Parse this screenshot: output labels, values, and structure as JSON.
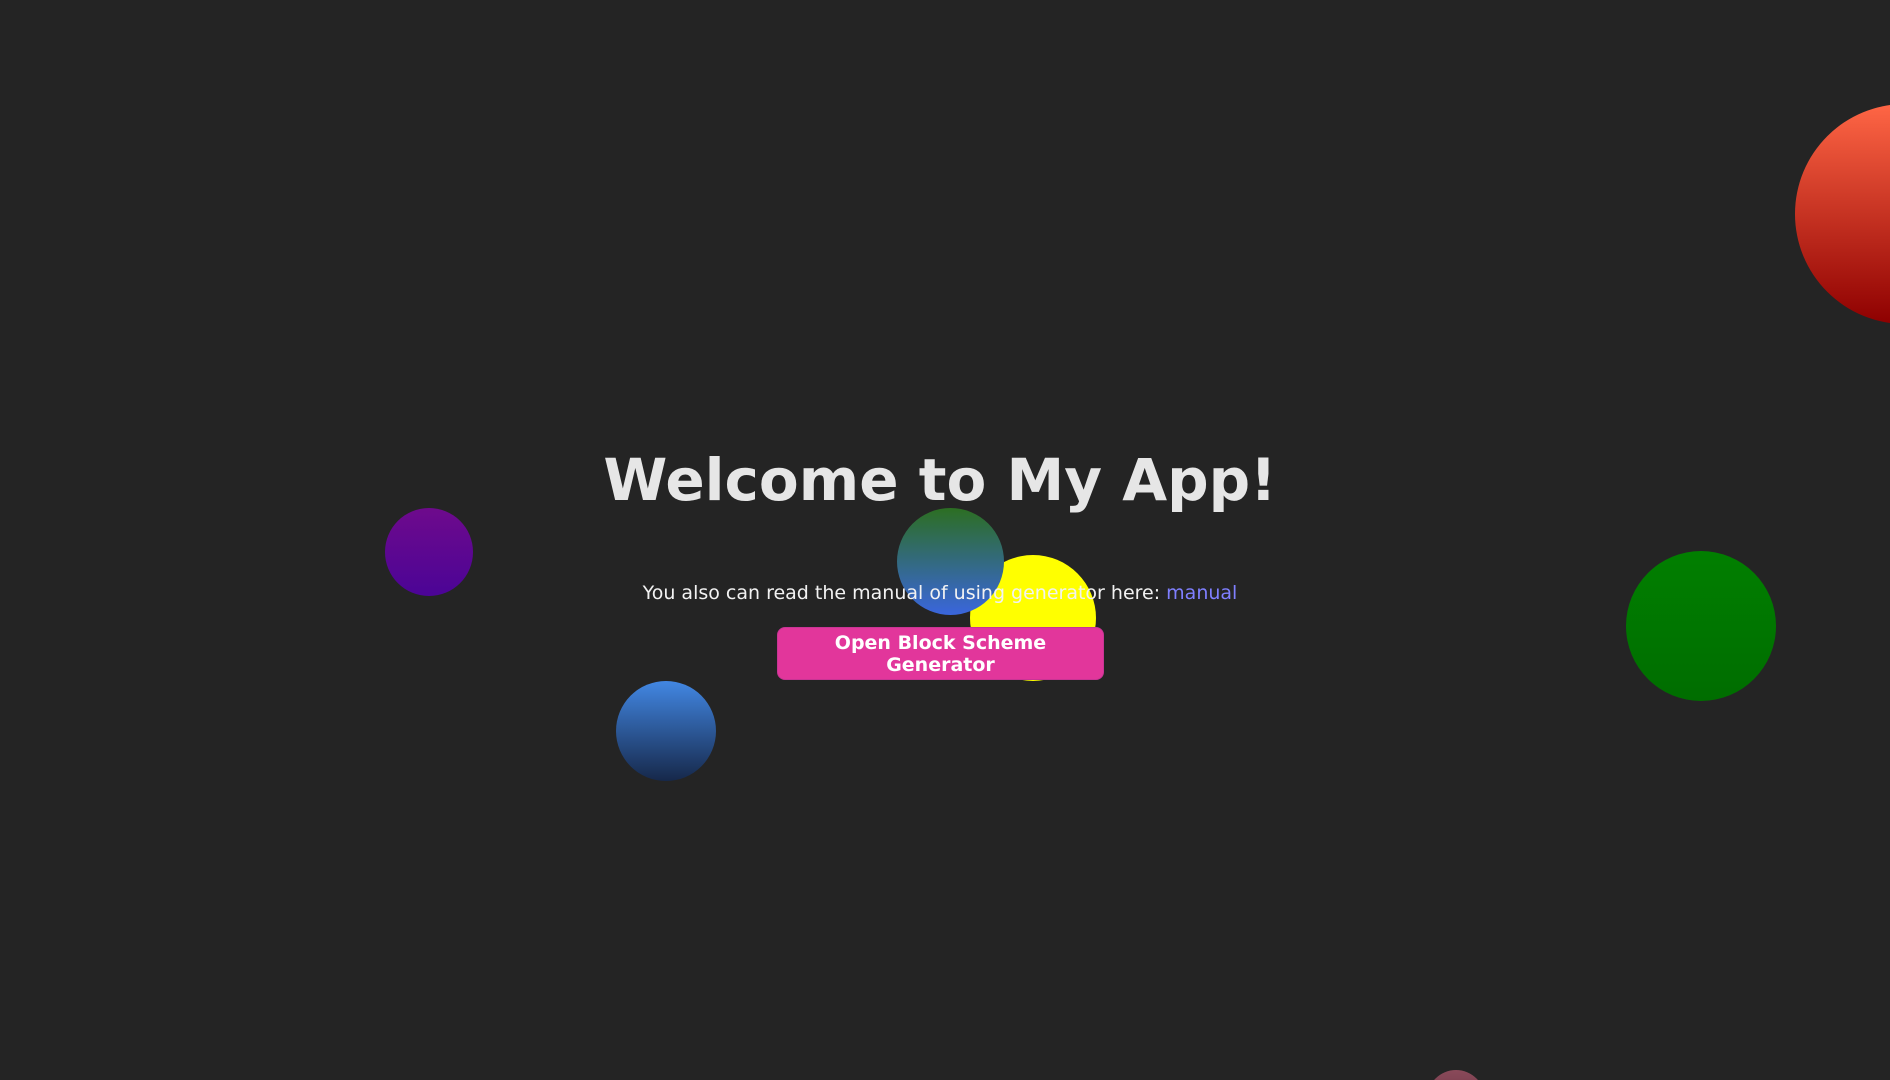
{
  "page": {
    "background_color": "#242424"
  },
  "hero": {
    "title": "Welcome to My App!",
    "manual_text": "You also can read the manual of using generator here: ",
    "manual_link": "manual",
    "open_button": "Open Block Scheme Generator"
  },
  "colors": {
    "title": "#e6e6e6",
    "link": "#7f7fff",
    "button": "#e2369b"
  },
  "decorations": [
    "purple-circle",
    "blue-gradient-circle",
    "yellow-circle",
    "green-blue-gradient-circle",
    "green-circle",
    "red-gradient-circle",
    "rose-circle"
  ]
}
